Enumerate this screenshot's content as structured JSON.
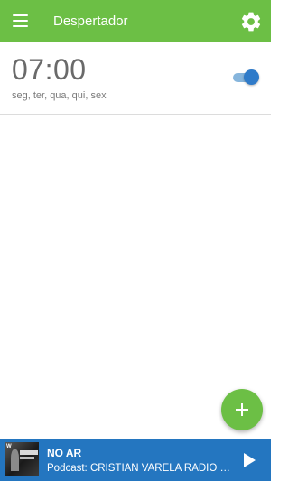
{
  "appbar": {
    "title": "Despertador",
    "color": "#6cbf45",
    "menu_icon": "hamburger-menu-icon",
    "settings_icon": "gear-icon"
  },
  "alarms": [
    {
      "time": "07:00",
      "days": "seg, ter, qua, qui, sex",
      "enabled": true
    }
  ],
  "fab": {
    "icon": "plus-icon",
    "color": "#6cbf45"
  },
  "player": {
    "status": "NO AR",
    "subtitle": "Podcast: CRISTIAN VARELA RADIO SHOW",
    "cover_mark": "W",
    "play_icon": "play-icon",
    "color": "#2476c0"
  }
}
